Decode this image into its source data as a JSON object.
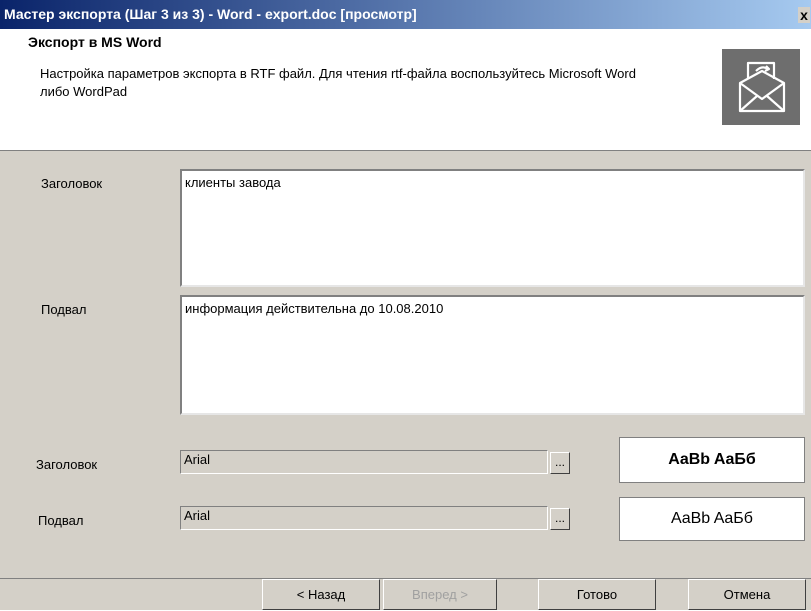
{
  "window": {
    "title": "Мастер экспорта (Шаг 3 из 3) - Word - export.doc [просмотр]",
    "close_label": "x",
    "titlebar_color_start": "#0a246a",
    "titlebar_color_end": "#a6caf0"
  },
  "header": {
    "title": "Экспорт в MS Word",
    "description": "Настройка параметров экспорта в RTF файл. Для чтения rtf-файла воспользуйтесь Microsoft Word либо WordPad",
    "logo_icon": "envelope-export-icon"
  },
  "text_fields": {
    "header_label": "Заголовок",
    "header_value": "клиенты завода",
    "footer_label": "Подвал",
    "footer_value": "информация действительна до 10.08.2010"
  },
  "fonts": {
    "header_label": "Заголовок",
    "header_font": "Arial",
    "header_preview": "AaBb AaБб",
    "footer_label": "Подвал",
    "footer_font": "Arial",
    "footer_preview": "AaBb AaБб",
    "browse_label": "..."
  },
  "buttons": {
    "back": "< Назад",
    "next": "Вперед >",
    "finish": "Готово",
    "cancel": "Отмена"
  }
}
